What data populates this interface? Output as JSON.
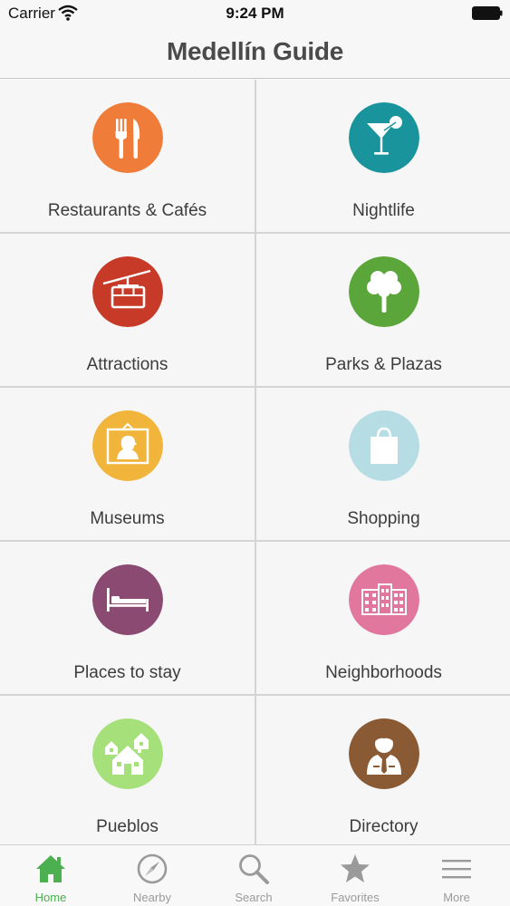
{
  "status_bar": {
    "carrier": "Carrier",
    "time": "9:24 PM"
  },
  "nav": {
    "title": "Medellín Guide"
  },
  "categories": [
    {
      "label": "Restaurants & Cafés",
      "icon": "fork-knife-icon",
      "color": "#f07c3a"
    },
    {
      "label": "Nightlife",
      "icon": "cocktail-icon",
      "color": "#1a949c"
    },
    {
      "label": "Attractions",
      "icon": "cable-car-icon",
      "color": "#c73a28"
    },
    {
      "label": "Parks & Plazas",
      "icon": "tree-icon",
      "color": "#5aa63a"
    },
    {
      "label": "Museums",
      "icon": "portrait-frame-icon",
      "color": "#f0b53a"
    },
    {
      "label": "Shopping",
      "icon": "shopping-bag-icon",
      "color": "#b6dde3"
    },
    {
      "label": "Places to stay",
      "icon": "bed-icon",
      "color": "#8a4a72"
    },
    {
      "label": "Neighborhoods",
      "icon": "buildings-icon",
      "color": "#e2779d"
    },
    {
      "label": "Pueblos",
      "icon": "village-houses-icon",
      "color": "#a5e07a"
    },
    {
      "label": "Directory",
      "icon": "person-directory-icon",
      "color": "#8a5a34"
    }
  ],
  "tabs": [
    {
      "label": "Home",
      "icon": "home-icon",
      "active": true
    },
    {
      "label": "Nearby",
      "icon": "compass-icon",
      "active": false
    },
    {
      "label": "Search",
      "icon": "magnifier-icon",
      "active": false
    },
    {
      "label": "Favorites",
      "icon": "star-icon",
      "active": false
    },
    {
      "label": "More",
      "icon": "menu-lines-icon",
      "active": false
    }
  ],
  "colors": {
    "accent": "#4caf50",
    "inactive_tab": "#9a9a9a",
    "title": "#4a4a4a"
  }
}
